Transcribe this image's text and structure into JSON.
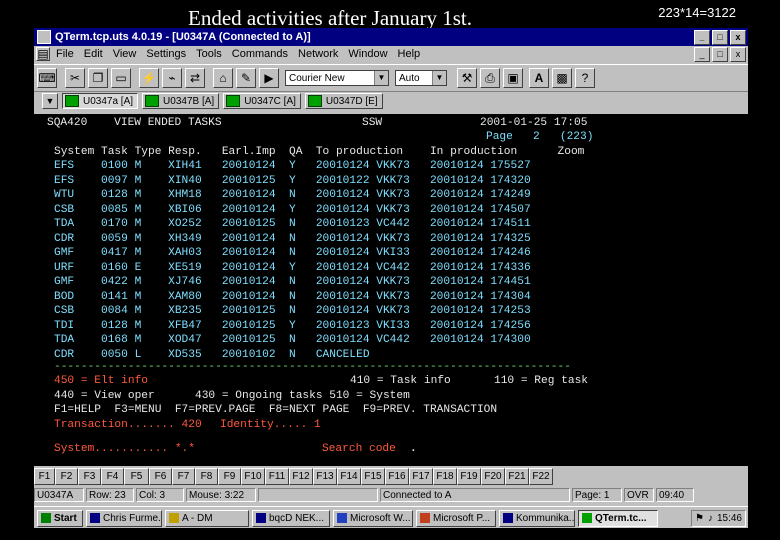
{
  "slide": {
    "title": "Ended activities after January 1st.",
    "corner": "223*14=3122"
  },
  "window": {
    "title": "QTerm.tcp.uts 4.0.19 - [U0347A (Connected to A)]",
    "buttons": [
      "_",
      "□",
      "x"
    ]
  },
  "menu": [
    "File",
    "Edit",
    "View",
    "Settings",
    "Tools",
    "Commands",
    "Network",
    "Window",
    "Help"
  ],
  "toolbar": {
    "icons": [
      "keyboard-icon",
      "cut-icon",
      "copy-icon",
      "paste-icon",
      "connect-icon",
      "disconnect-icon",
      "transfer-icon",
      "home-icon",
      "edit-icon",
      "play-icon"
    ],
    "font_combo": "Courier New",
    "size_combo": "Auto",
    "right_icons": [
      "tools-icon",
      "print-icon",
      "save-icon",
      "font-a-icon",
      "image-icon",
      "help-icon"
    ]
  },
  "sessions": [
    {
      "label": "U0347a [A]",
      "active": true
    },
    {
      "label": "U0347B [A]",
      "active": false
    },
    {
      "label": "U0347C [A]",
      "active": false
    },
    {
      "label": "U0347D [E]",
      "active": false
    }
  ],
  "terminal": {
    "header_left": "SQA420    VIEW ENDED TASKS",
    "header_mid": "SSW",
    "header_date": "2001-01-25 17:05",
    "page_line": "Page   2   (223)",
    "col_header": "System Task Type Resp.   Earl.Imp  QA  To production    In production      Zoom",
    "rows": [
      "EFS    0100 M    XIH41   20010124  Y   20010124 VKK73   20010124 175527",
      "EFS    0097 M    XIN40   20010125  Y   20010122 VKK73   20010124 174320",
      "WTU    0128 M    XHM18   20010124  N   20010124 VKK73   20010124 174249",
      "CSB    0085 M    XBI06   20010124  Y   20010124 VKK73   20010124 174507",
      "TDA    0170 M    XO252   20010125  N   20010123 VC442   20010124 174511",
      "CDR    0059 M    XH349   20010124  N   20010124 VKK73   20010124 174325",
      "GMF    0417 M    XAH03   20010124  N   20010124 VKI33   20010124 174246",
      "URF    0160 E    XE519   20010124  Y   20010124 VC442   20010124 174336",
      "GMF    0422 M    XJ746   20010124  N   20010124 VKK73   20010124 174451",
      "BOD    0141 M    XAM80   20010124  N   20010124 VKK73   20010124 174304",
      "CSB    0084 M    XB235   20010125  N   20010124 VKK73   20010124 174253",
      "TDI    0128 M    XFB47   20010125  Y   20010123 VKI33   20010124 174256",
      "TDA    0168 M    XOD47   20010125  N   20010124 VC442   20010124 174300",
      "CDR    0050 L    XD535   20010102  N   CANCELED"
    ],
    "separator": "-----------------------------------------------------------------------------",
    "opt1_left": "450 = Elt info",
    "opt1_mid": "410 = Task info",
    "opt1_right": "110 = Reg task",
    "opt2": "440 = View oper      430 = Ongoing tasks 510 = System",
    "fkey_line": "F1=HELP  F3=MENU  F7=PREV.PAGE  F8=NEXT PAGE  F9=PREV. TRANSACTION",
    "trans_label": "Transaction....... 420",
    "identity_label": "Identity..... 1",
    "system_label": "System........... *.*",
    "search_label": "Search code",
    "search_cursor": "."
  },
  "fkeys": [
    "F1",
    "F2",
    "F3",
    "F4",
    "F5",
    "F6",
    "F7",
    "F8",
    "F9",
    "F10",
    "F11",
    "F12",
    "F13",
    "F14",
    "F15",
    "F16",
    "F17",
    "F18",
    "F19",
    "F20",
    "F21",
    "F22"
  ],
  "status": {
    "session": "U0347A",
    "row": "Row: 23",
    "col": "Col: 3",
    "mouse": "Mouse: 3:22",
    "connected": "Connected to A",
    "page": "Page: 1",
    "ovr": "OVR",
    "time": "09:40"
  },
  "taskbar": {
    "start": "Start",
    "tasks": [
      {
        "label": "Chris Furme...",
        "active": false
      },
      {
        "label": "A - DM",
        "active": false
      },
      {
        "label": "bqcD NEK...",
        "active": false
      },
      {
        "label": "Microsoft W...",
        "active": false
      },
      {
        "label": "Microsoft P...",
        "active": false
      },
      {
        "label": "Kommunika...",
        "active": false
      },
      {
        "label": "QTerm.tc...",
        "active": true
      }
    ],
    "clock": "15:46"
  }
}
